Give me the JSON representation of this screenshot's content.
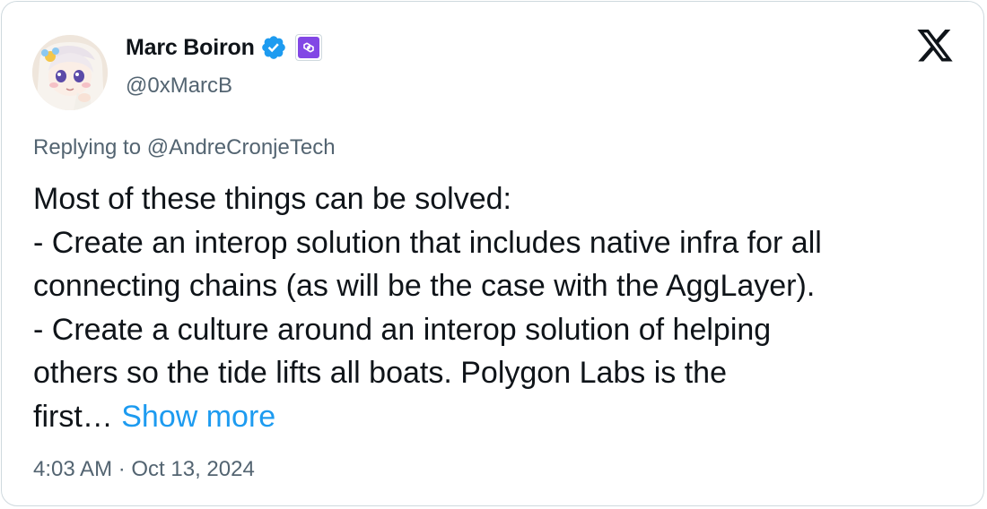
{
  "author": {
    "name": "Marc Boiron",
    "handle": "@0xMarcB",
    "verified_icon": "verified-badge-icon",
    "affiliate_icon": "polygon-affiliate-icon"
  },
  "platform": {
    "logo_icon": "x-logo-icon"
  },
  "reply": {
    "text": "Replying to @AndreCronjeTech"
  },
  "tweet": {
    "lines": [
      "Most of these things can be solved:",
      "- Create an interop solution that includes native infra for all",
      "connecting chains (as will be the case with the AggLayer).",
      "- Create a culture around an interop solution of helping",
      "others so the tide lifts all boats. Polygon Labs is the",
      "first…"
    ],
    "show_more": "Show more"
  },
  "timestamp": "4:03 AM · Oct 13, 2024",
  "colors": {
    "text": "#0f1419",
    "secondary": "#536471",
    "link": "#1d9bf0",
    "verified": "#1d9bf0",
    "affiliate": "#8247e5",
    "border": "#cfd9de"
  }
}
